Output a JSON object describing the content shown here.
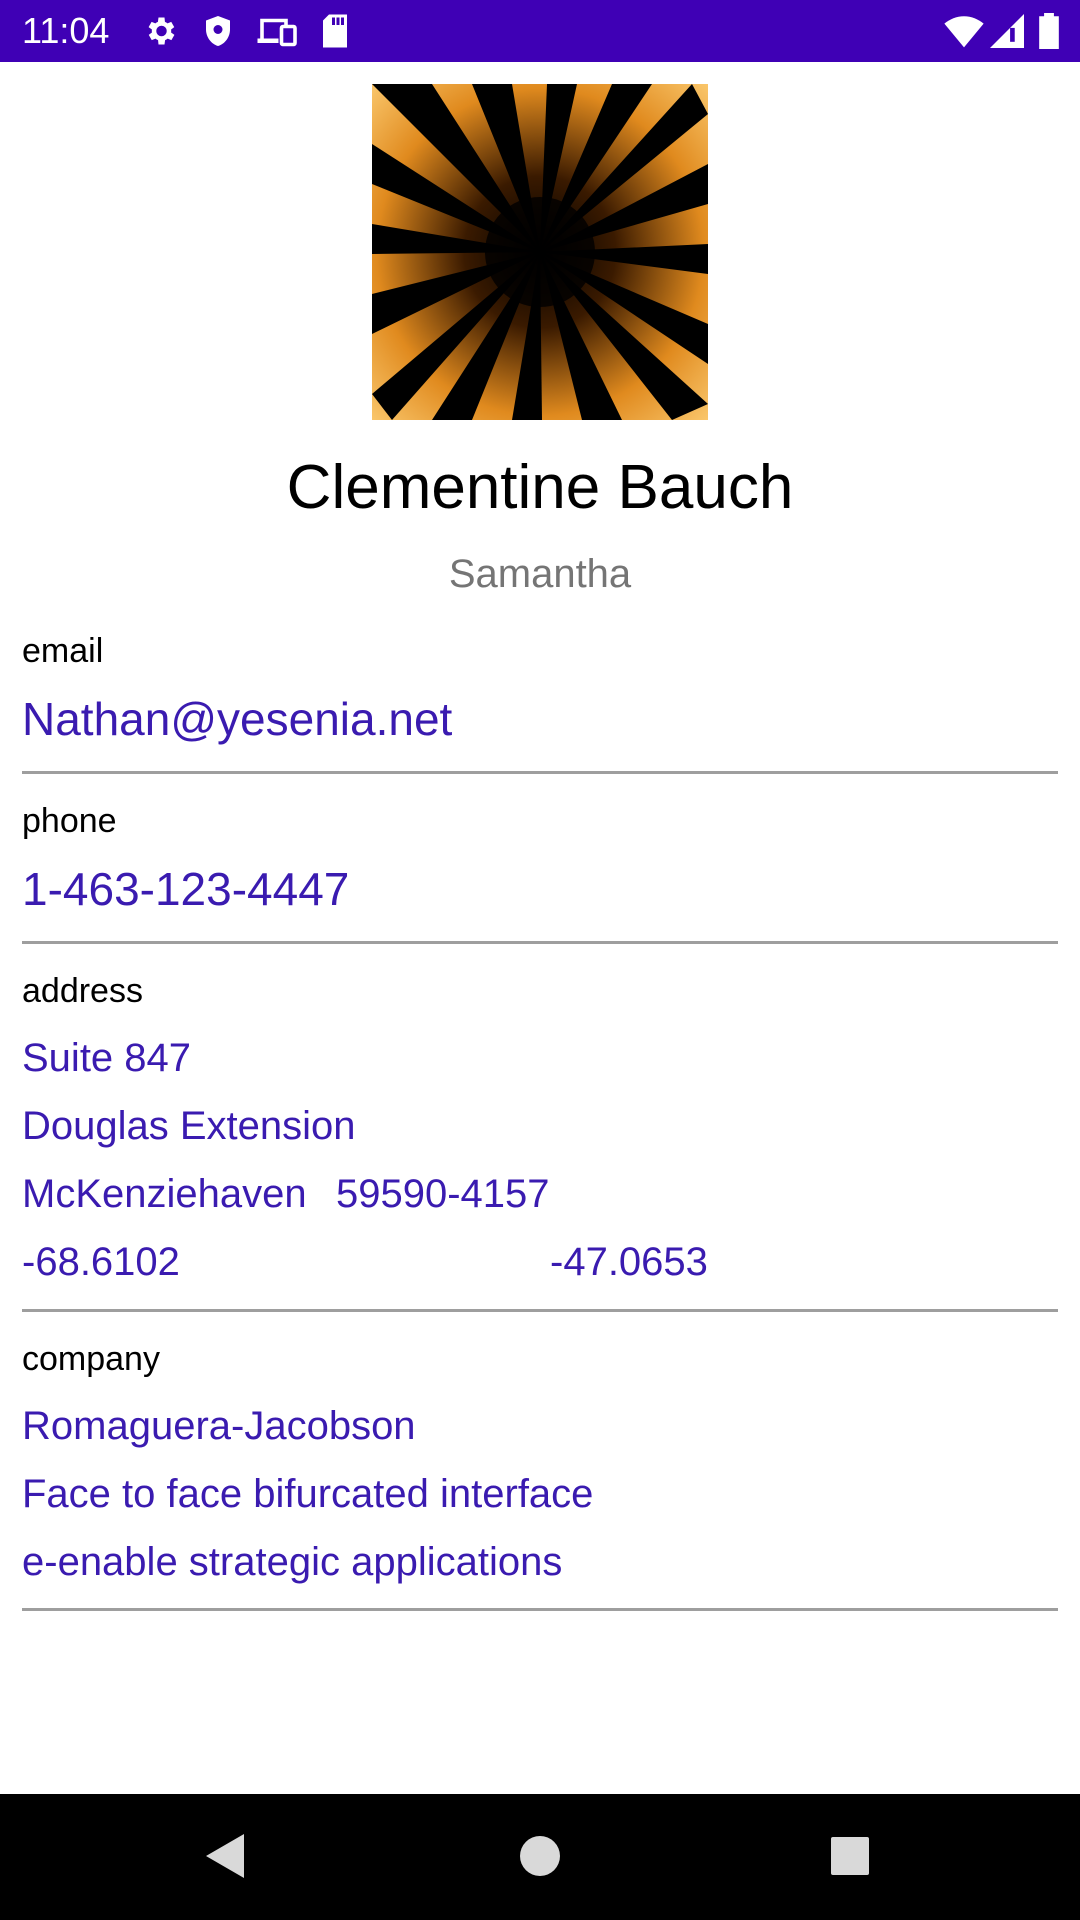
{
  "status_bar": {
    "time": "11:04",
    "icons_left": [
      "gear-icon",
      "shield-icon",
      "devices-icon",
      "sd-card-icon"
    ],
    "icons_right": [
      "wifi-icon",
      "signal-icon",
      "battery-icon"
    ],
    "background": "#3f00b5"
  },
  "contact": {
    "name": "Clementine Bauch",
    "nickname": "Samantha",
    "email": {
      "label": "email",
      "value": "Nathan@yesenia.net"
    },
    "phone": {
      "label": "phone",
      "value": "1-463-123-4447"
    },
    "address": {
      "label": "address",
      "suite": "Suite 847",
      "street": "Douglas Extension",
      "city": "McKenziehaven",
      "zipcode": "59590-4157",
      "lat": "-68.6102",
      "lng": "-47.0653"
    },
    "company": {
      "label": "company",
      "name": "Romaguera-Jacobson",
      "catch_phrase": "Face to face bifurcated interface",
      "bs": "e-enable strategic applications"
    }
  },
  "colors": {
    "accent": "#3a1bb0",
    "secondary_text": "#757575",
    "divider": "#9e9e9e"
  },
  "nav_bar": {
    "buttons": [
      "back-icon",
      "home-icon",
      "recents-icon"
    ]
  }
}
